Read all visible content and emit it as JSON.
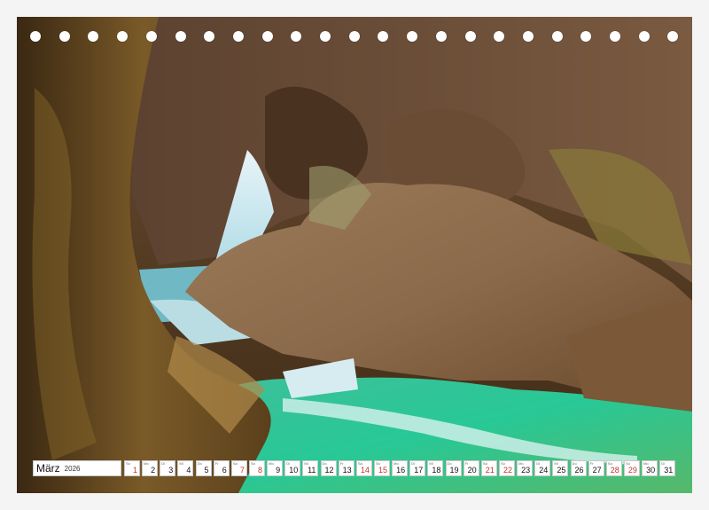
{
  "calendar": {
    "month": "März",
    "year": "2026",
    "days": [
      {
        "n": "1",
        "d": "So",
        "weekend": true
      },
      {
        "n": "2",
        "d": "Mo",
        "weekend": false
      },
      {
        "n": "3",
        "d": "Di",
        "weekend": false
      },
      {
        "n": "4",
        "d": "Mi",
        "weekend": false
      },
      {
        "n": "5",
        "d": "Do",
        "weekend": false
      },
      {
        "n": "6",
        "d": "Fr",
        "weekend": false
      },
      {
        "n": "7",
        "d": "Sa",
        "weekend": true
      },
      {
        "n": "8",
        "d": "So",
        "weekend": true
      },
      {
        "n": "9",
        "d": "Mo",
        "weekend": false
      },
      {
        "n": "10",
        "d": "Di",
        "weekend": false
      },
      {
        "n": "11",
        "d": "Mi",
        "weekend": false
      },
      {
        "n": "12",
        "d": "Do",
        "weekend": false
      },
      {
        "n": "13",
        "d": "Fr",
        "weekend": false
      },
      {
        "n": "14",
        "d": "Sa",
        "weekend": true
      },
      {
        "n": "15",
        "d": "So",
        "weekend": true
      },
      {
        "n": "16",
        "d": "Mo",
        "weekend": false
      },
      {
        "n": "17",
        "d": "Di",
        "weekend": false
      },
      {
        "n": "18",
        "d": "Mi",
        "weekend": false
      },
      {
        "n": "19",
        "d": "Do",
        "weekend": false
      },
      {
        "n": "20",
        "d": "Fr",
        "weekend": false
      },
      {
        "n": "21",
        "d": "Sa",
        "weekend": true
      },
      {
        "n": "22",
        "d": "So",
        "weekend": true
      },
      {
        "n": "23",
        "d": "Mo",
        "weekend": false
      },
      {
        "n": "24",
        "d": "Di",
        "weekend": false
      },
      {
        "n": "25",
        "d": "Mi",
        "weekend": false
      },
      {
        "n": "26",
        "d": "Do",
        "weekend": false
      },
      {
        "n": "27",
        "d": "Fr",
        "weekend": false
      },
      {
        "n": "28",
        "d": "Sa",
        "weekend": true
      },
      {
        "n": "29",
        "d": "So",
        "weekend": true
      },
      {
        "n": "30",
        "d": "Mo",
        "weekend": false
      },
      {
        "n": "31",
        "d": "Di",
        "weekend": false
      }
    ]
  },
  "colors": {
    "weekend_text": "#c0392b",
    "rock_dark": "#4a3418",
    "rock_mid": "#8a6235",
    "rock_light": "#a88a6a",
    "water": "#2fc7a0"
  }
}
